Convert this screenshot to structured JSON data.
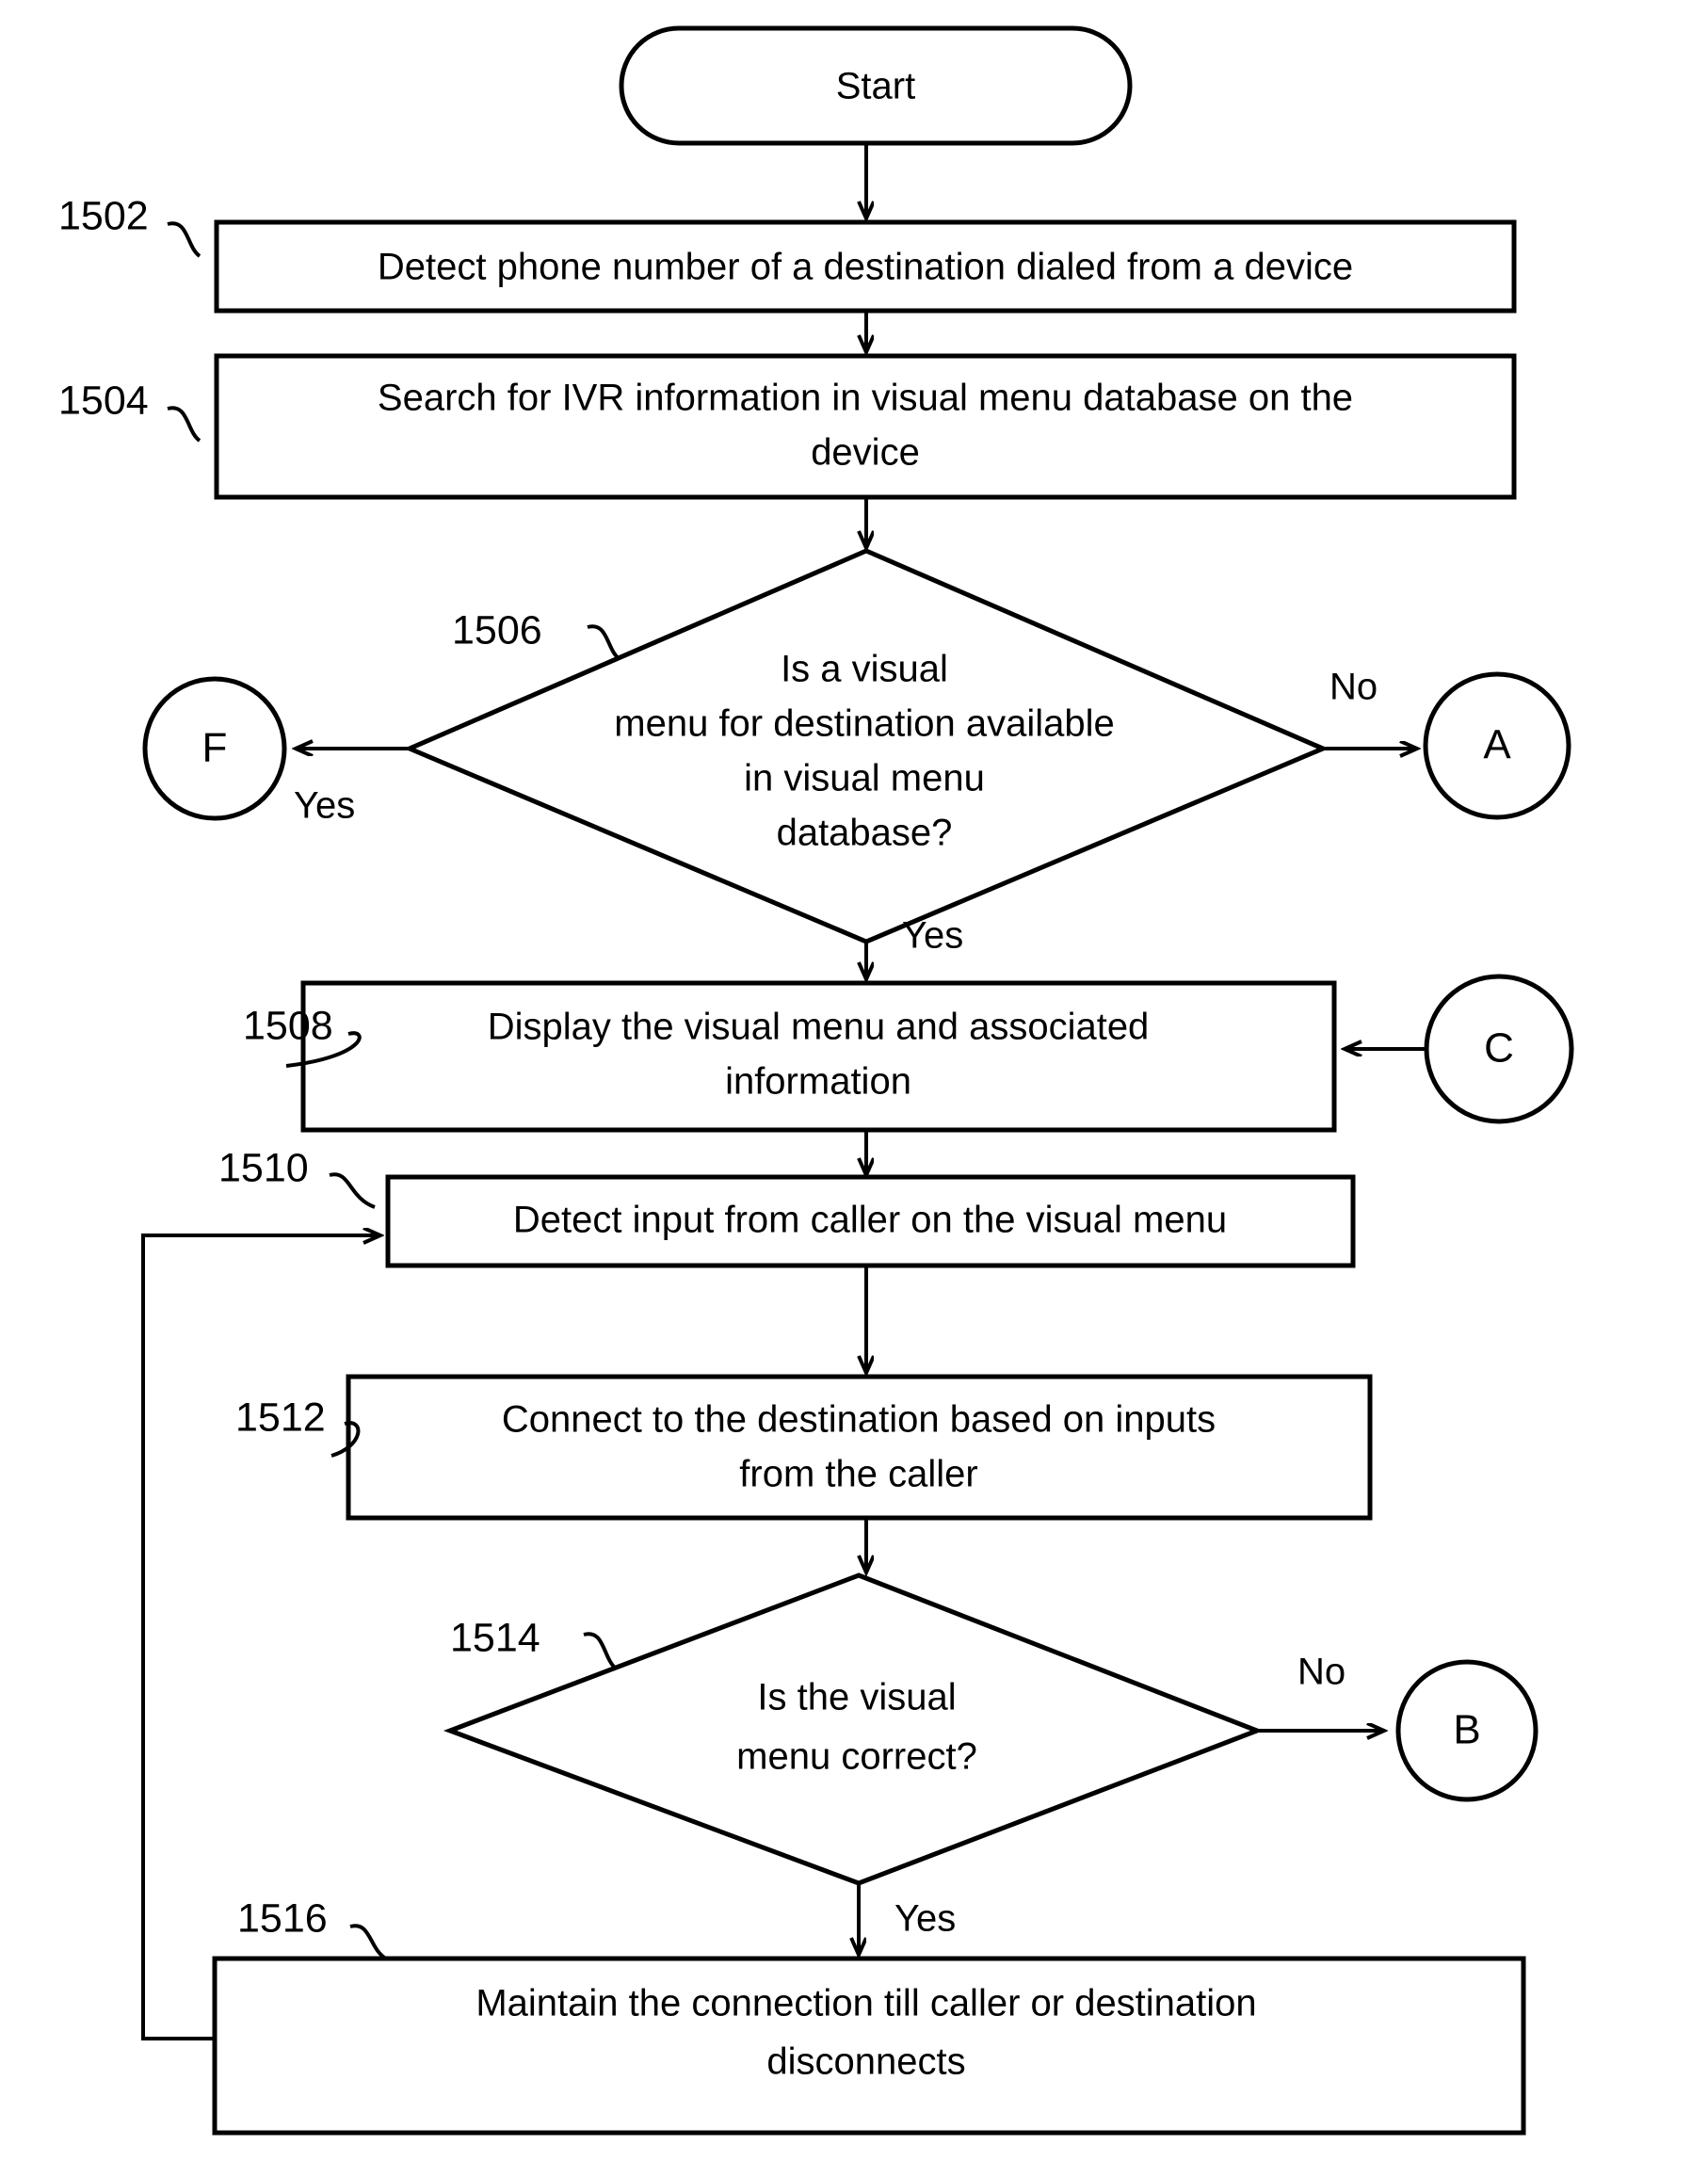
{
  "figure": {
    "type": "flowchart",
    "orientation": "vertical",
    "background_color": "#ffffff",
    "line_color": "#000000"
  },
  "nodes": {
    "start": {
      "shape": "terminator",
      "label": "Start"
    },
    "n1502": {
      "ref": "1502",
      "shape": "process",
      "label": "Detect phone number of a destination dialed from a device"
    },
    "n1504": {
      "ref": "1504",
      "shape": "process",
      "line1": "Search for IVR information in visual menu database on the",
      "line2": "device"
    },
    "n1506": {
      "ref": "1506",
      "shape": "decision",
      "line1": "Is a visual",
      "line2": "menu for destination available",
      "line3": "in visual menu",
      "line4": "database?"
    },
    "n1508": {
      "ref": "1508",
      "shape": "process",
      "line1": "Display the visual menu and associated",
      "line2": "information"
    },
    "n1510": {
      "ref": "1510",
      "shape": "process",
      "label": "Detect input from caller on the visual menu"
    },
    "n1512": {
      "ref": "1512",
      "shape": "process",
      "line1": "Connect to the destination based on inputs",
      "line2": "from the caller"
    },
    "n1514": {
      "ref": "1514",
      "shape": "decision",
      "line1": "Is the visual",
      "line2": "menu correct?"
    },
    "n1516": {
      "ref": "1516",
      "shape": "process",
      "line1": "Maintain the connection till caller or destination",
      "line2": "disconnects"
    }
  },
  "connectors": {
    "f": {
      "shape": "circle",
      "label": "F"
    },
    "a": {
      "shape": "circle",
      "label": "A"
    },
    "c": {
      "shape": "circle",
      "label": "C"
    },
    "b": {
      "shape": "circle",
      "label": "B"
    }
  },
  "edge_labels": {
    "d1506_yes_left": "Yes",
    "d1506_no_right": "No",
    "d1506_yes_down": "Yes",
    "d1514_no_right": "No",
    "d1514_yes_down": "Yes"
  }
}
